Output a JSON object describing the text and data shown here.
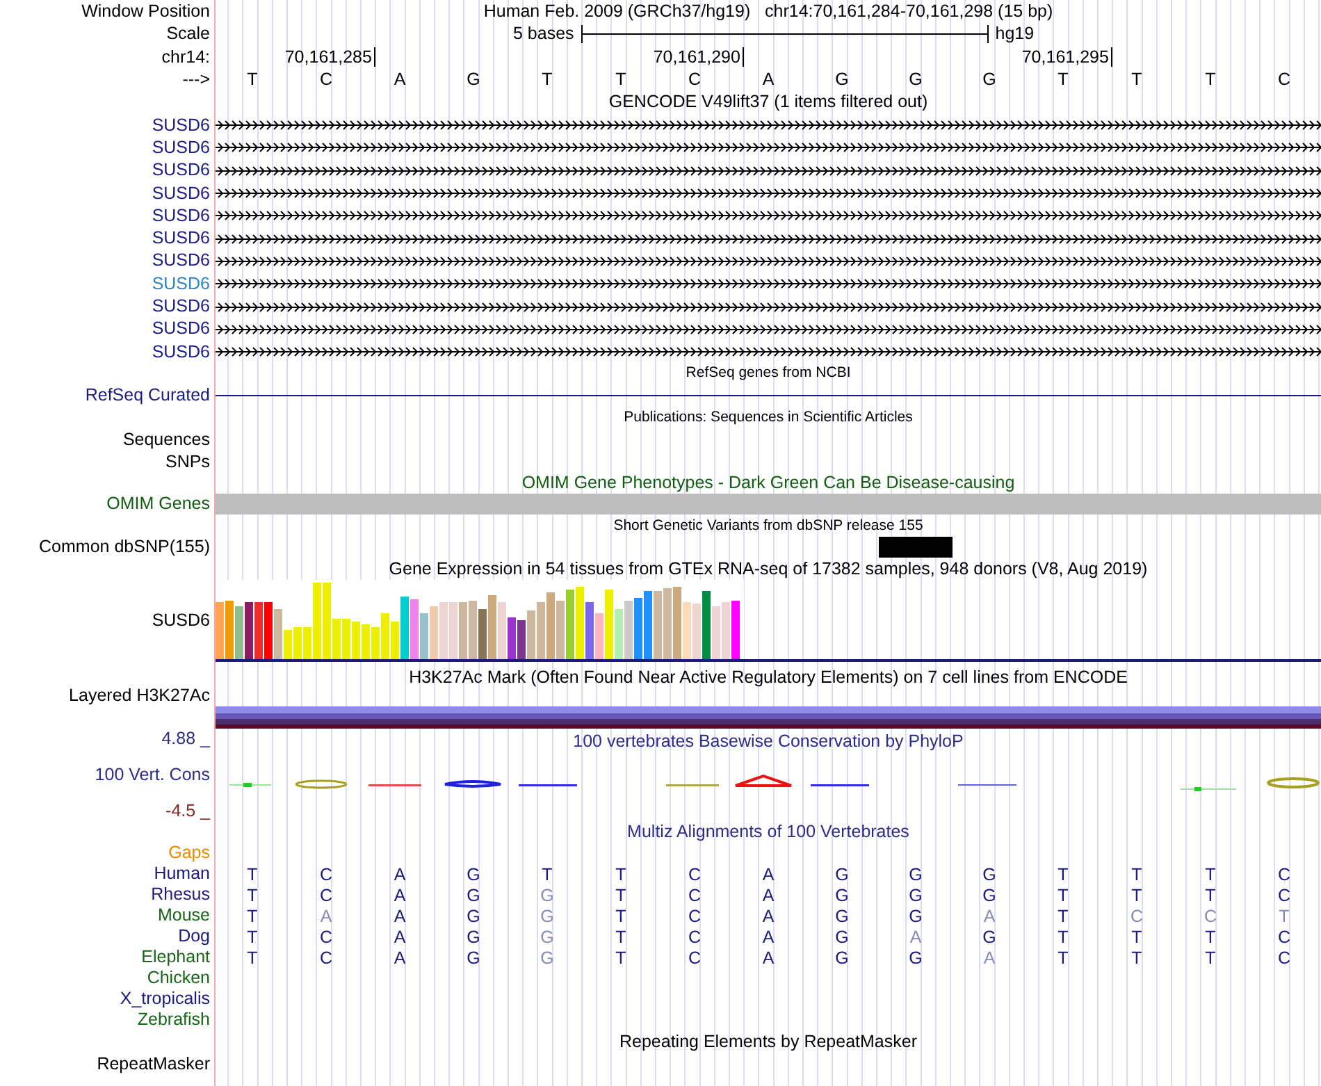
{
  "header": {
    "window_position_label": "Window Position",
    "window_position": "Human Feb. 2009 (GRCh37/hg19)   chr14:70,161,284-70,161,298 (15 bp)",
    "scale_label": "Scale",
    "scale_text": "5 bases",
    "scale_assembly": "hg19",
    "chrom_label": "chr14:",
    "positions": [
      "70,161,285",
      "70,161,290",
      "70,161,295"
    ],
    "strand_label": "--->",
    "bases": [
      "T",
      "C",
      "A",
      "G",
      "T",
      "T",
      "C",
      "A",
      "G",
      "G",
      "G",
      "T",
      "T",
      "T",
      "C"
    ]
  },
  "tracks": [
    {
      "kind": "genes",
      "title": "GENCODE V49lift37 (1 items filtered out)",
      "items": [
        {
          "name": "SUSD6",
          "color": "#1a1a8c"
        },
        {
          "name": "SUSD6",
          "color": "#1a1a8c"
        },
        {
          "name": "SUSD6",
          "color": "#1a1a8c"
        },
        {
          "name": "SUSD6",
          "color": "#1a1a8c"
        },
        {
          "name": "SUSD6",
          "color": "#1a1a8c"
        },
        {
          "name": "SUSD6",
          "color": "#1a1a8c"
        },
        {
          "name": "SUSD6",
          "color": "#1a1a8c"
        },
        {
          "name": "SUSD6",
          "color": "#2b86c4"
        },
        {
          "name": "SUSD6",
          "color": "#1a1a8c"
        },
        {
          "name": "SUSD6",
          "color": "#1a1a8c"
        },
        {
          "name": "SUSD6",
          "color": "#1a1a8c"
        }
      ]
    },
    {
      "kind": "line",
      "title": "RefSeq genes from NCBI",
      "labels": [
        "RefSeq Curated"
      ]
    },
    {
      "kind": "sparse",
      "title": "Publications: Sequences in Scientific Articles",
      "labels": [
        "Sequences",
        "SNPs"
      ]
    },
    {
      "kind": "bar",
      "title": "OMIM Gene Phenotypes - Dark Green Can Be Disease-causing",
      "labels": [
        "OMIM Genes"
      ]
    },
    {
      "kind": "snp",
      "title": "Short Genetic Variants from dbSNP release 155",
      "labels": [
        "Common dbSNP(155)"
      ]
    },
    {
      "kind": "expression",
      "title": "Gene Expression in 54 tissues from GTEx RNA-seq of 17382 samples, 948 donors (V8, Aug 2019)",
      "labels": [
        "SUSD6"
      ]
    },
    {
      "kind": "layered",
      "title": "H3K27Ac Mark (Often Found Near Active Regulatory Elements) on 7 cell lines from ENCODE",
      "labels": [
        "Layered H3K27Ac"
      ]
    },
    {
      "kind": "wiggle",
      "title": "100 vertebrates Basewise Conservation by PhyloP",
      "labels": [
        "4.88 _",
        "100 Vert. Cons",
        "-4.5 _"
      ]
    },
    {
      "kind": "alignment",
      "title": "Multiz Alignments of 100 Vertebrates",
      "labels": [
        "Gaps"
      ],
      "species": [
        {
          "name": "Human",
          "color": "#1a1a80",
          "bases": [
            {
              "b": "T",
              "match": true
            },
            {
              "b": "C",
              "match": true
            },
            {
              "b": "A",
              "match": true
            },
            {
              "b": "G",
              "match": true
            },
            {
              "b": "T",
              "match": true
            },
            {
              "b": "T",
              "match": true
            },
            {
              "b": "C",
              "match": true
            },
            {
              "b": "A",
              "match": true
            },
            {
              "b": "G",
              "match": true
            },
            {
              "b": "G",
              "match": true
            },
            {
              "b": "G",
              "match": true
            },
            {
              "b": "T",
              "match": true
            },
            {
              "b": "T",
              "match": true
            },
            {
              "b": "T",
              "match": true
            },
            {
              "b": "C",
              "match": true
            }
          ]
        },
        {
          "name": "Rhesus",
          "color": "#1a1a80",
          "bases": [
            {
              "b": "T",
              "match": true
            },
            {
              "b": "C",
              "match": true
            },
            {
              "b": "A",
              "match": true
            },
            {
              "b": "G",
              "match": true
            },
            {
              "b": "G",
              "match": false
            },
            {
              "b": "T",
              "match": true
            },
            {
              "b": "C",
              "match": true
            },
            {
              "b": "A",
              "match": true
            },
            {
              "b": "G",
              "match": true
            },
            {
              "b": "G",
              "match": true
            },
            {
              "b": "G",
              "match": true
            },
            {
              "b": "T",
              "match": true
            },
            {
              "b": "T",
              "match": true
            },
            {
              "b": "T",
              "match": true
            },
            {
              "b": "C",
              "match": true
            }
          ]
        },
        {
          "name": "Mouse",
          "color": "#156615",
          "bases": [
            {
              "b": "T",
              "match": true
            },
            {
              "b": "A",
              "match": false
            },
            {
              "b": "A",
              "match": true
            },
            {
              "b": "G",
              "match": true
            },
            {
              "b": "G",
              "match": false
            },
            {
              "b": "T",
              "match": true
            },
            {
              "b": "C",
              "match": true
            },
            {
              "b": "A",
              "match": true
            },
            {
              "b": "G",
              "match": true
            },
            {
              "b": "G",
              "match": true
            },
            {
              "b": "A",
              "match": false
            },
            {
              "b": "T",
              "match": true
            },
            {
              "b": "C",
              "match": false
            },
            {
              "b": "C",
              "match": false
            },
            {
              "b": "T",
              "match": false
            }
          ]
        },
        {
          "name": "Dog",
          "color": "#1a1a80",
          "bases": [
            {
              "b": "T",
              "match": true
            },
            {
              "b": "C",
              "match": true
            },
            {
              "b": "A",
              "match": true
            },
            {
              "b": "G",
              "match": true
            },
            {
              "b": "G",
              "match": false
            },
            {
              "b": "T",
              "match": true
            },
            {
              "b": "C",
              "match": true
            },
            {
              "b": "A",
              "match": true
            },
            {
              "b": "G",
              "match": true
            },
            {
              "b": "A",
              "match": false
            },
            {
              "b": "G",
              "match": true
            },
            {
              "b": "T",
              "match": true
            },
            {
              "b": "T",
              "match": true
            },
            {
              "b": "T",
              "match": true
            },
            {
              "b": "C",
              "match": true
            }
          ]
        },
        {
          "name": "Elephant",
          "color": "#156615",
          "bases": [
            {
              "b": "T",
              "match": true
            },
            {
              "b": "C",
              "match": true
            },
            {
              "b": "A",
              "match": true
            },
            {
              "b": "G",
              "match": true
            },
            {
              "b": "G",
              "match": false
            },
            {
              "b": "T",
              "match": true
            },
            {
              "b": "C",
              "match": true
            },
            {
              "b": "A",
              "match": true
            },
            {
              "b": "G",
              "match": true
            },
            {
              "b": "G",
              "match": true
            },
            {
              "b": "A",
              "match": false
            },
            {
              "b": "T",
              "match": true
            },
            {
              "b": "T",
              "match": true
            },
            {
              "b": "T",
              "match": true
            },
            {
              "b": "C",
              "match": true
            }
          ]
        },
        {
          "name": "Chicken",
          "color": "#156615"
        },
        {
          "name": "X_tropicalis",
          "color": "#1a1a80"
        },
        {
          "name": "Zebrafish",
          "color": "#156615"
        }
      ]
    },
    {
      "kind": "empty",
      "title": "Repeating Elements by RepeatMasker",
      "labels": [
        "RepeatMasker"
      ]
    }
  ]
}
